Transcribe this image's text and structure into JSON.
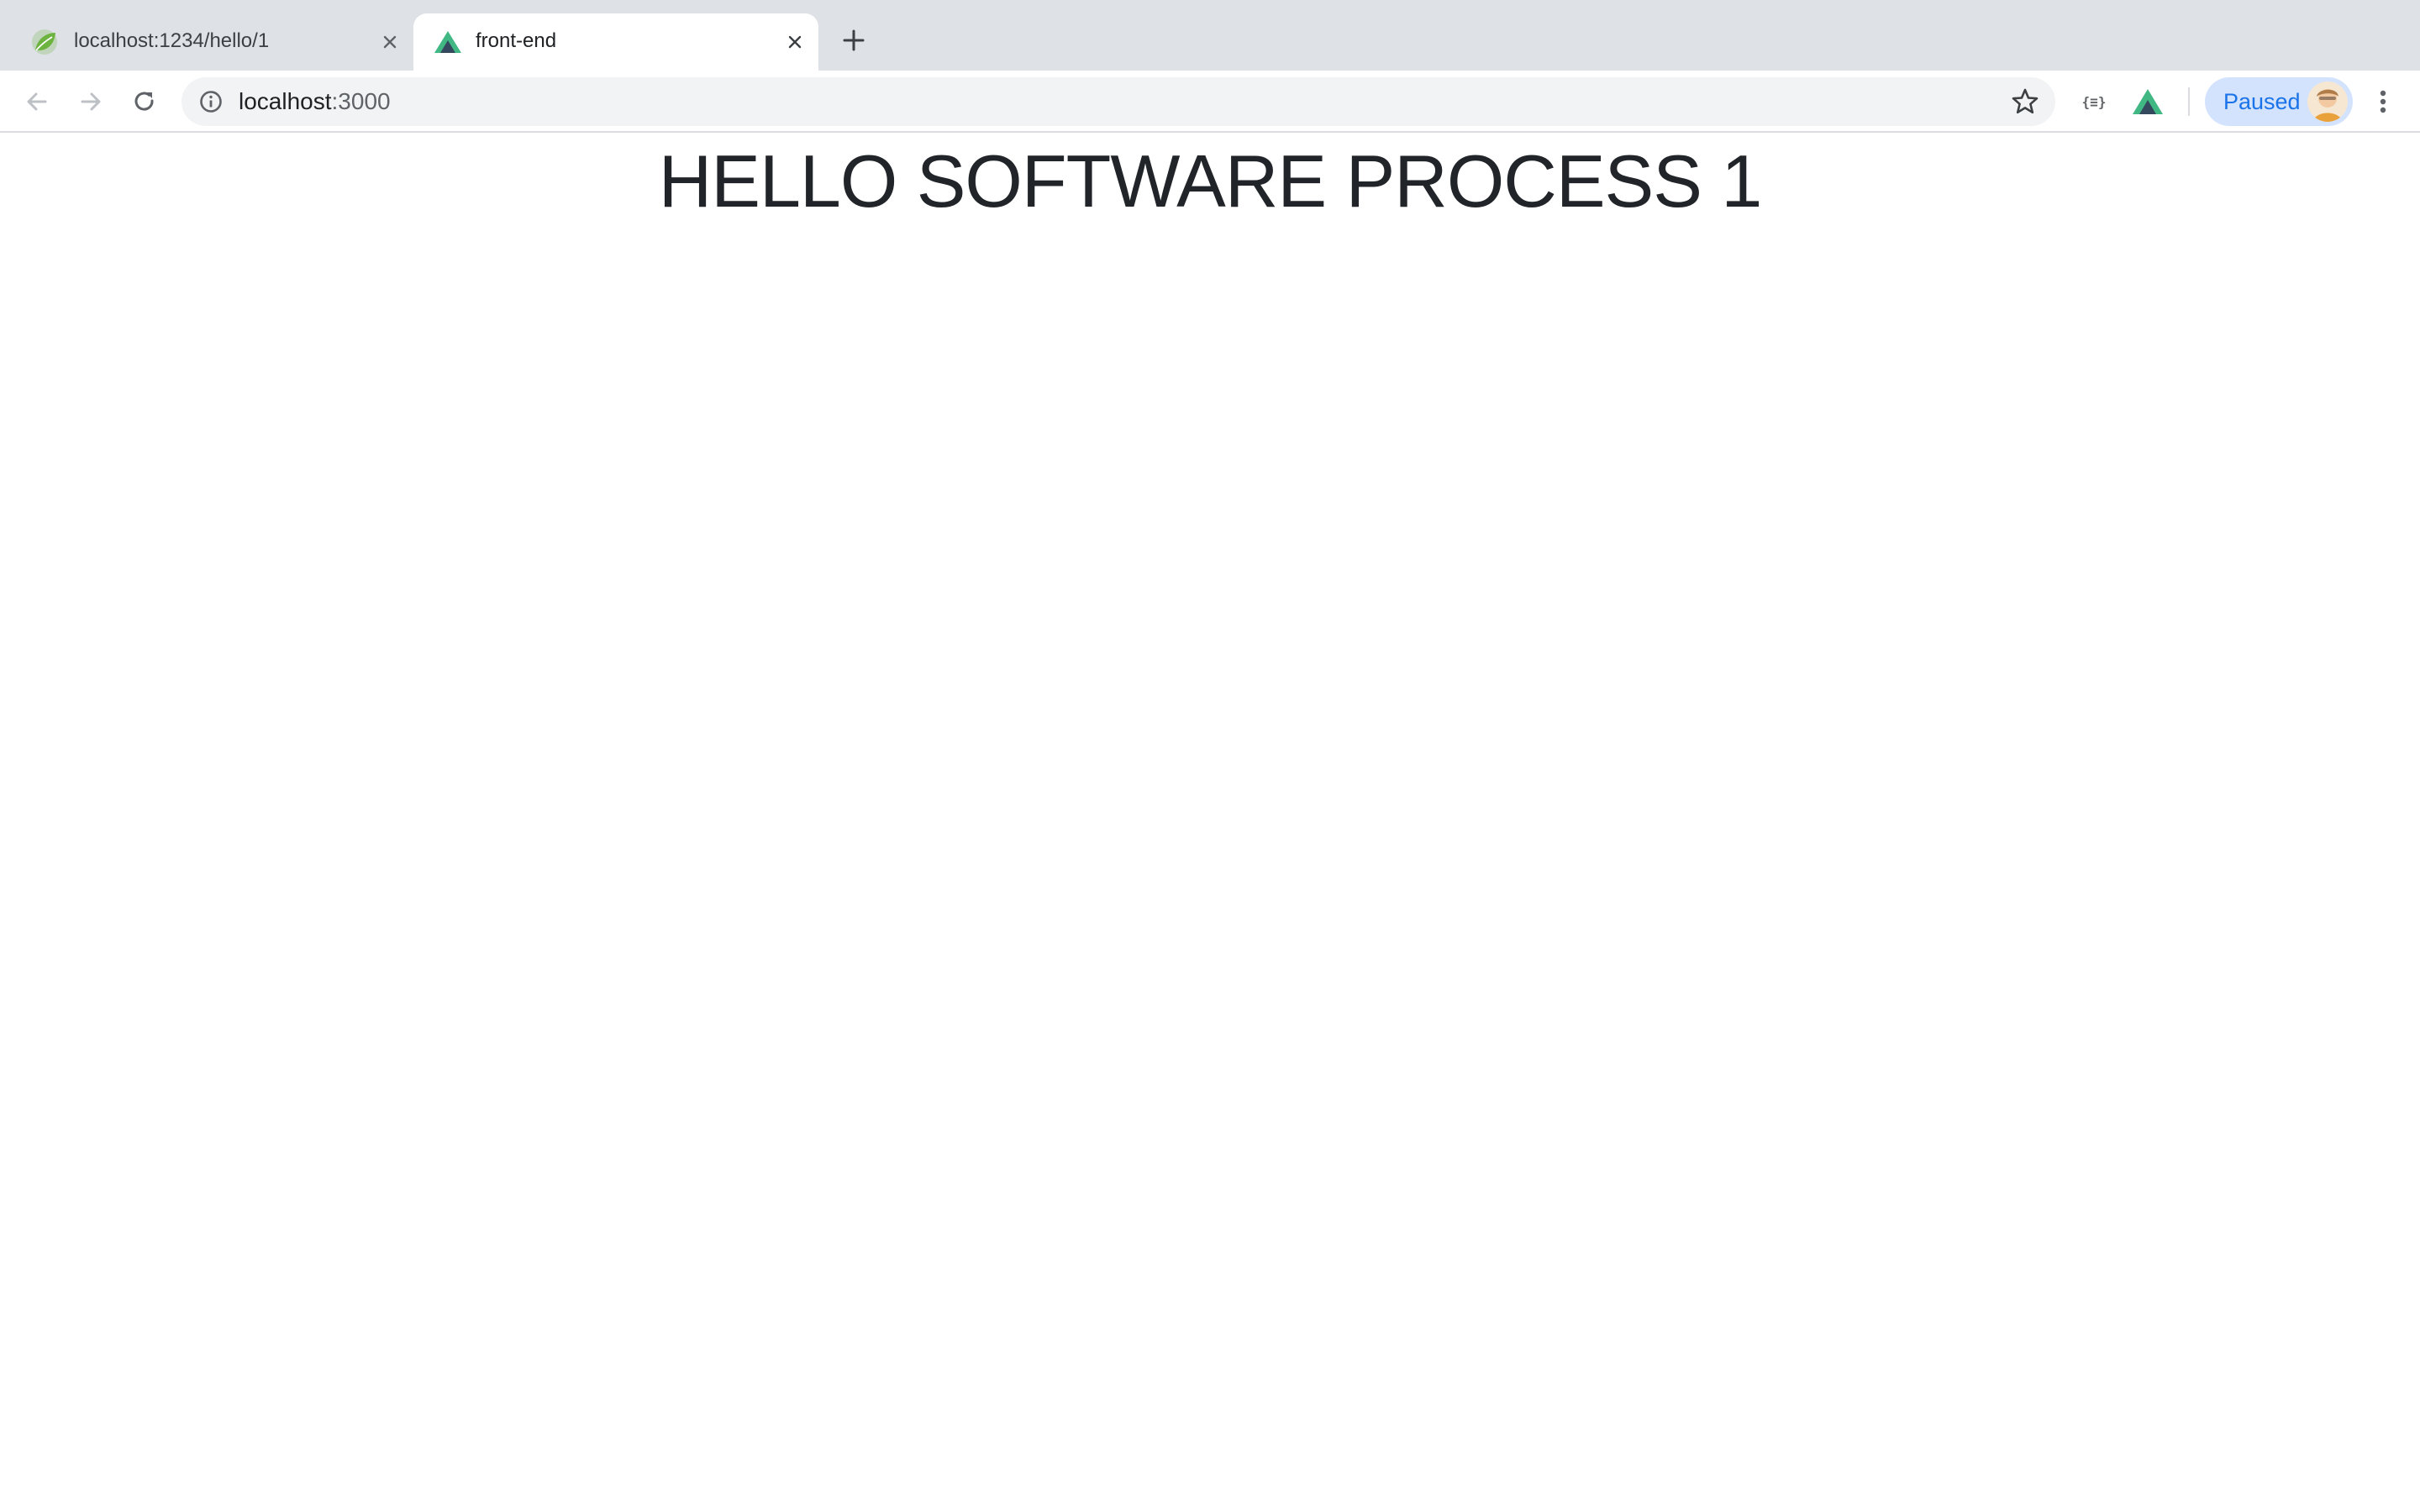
{
  "browser": {
    "tabs": [
      {
        "title": "localhost:1234/hello/1",
        "favicon": "spring-leaf-icon",
        "active": false
      },
      {
        "title": "front-end",
        "favicon": "vue-logo-icon",
        "active": true
      }
    ],
    "new_tab_icon": "plus-icon",
    "address_bar": {
      "host": "localhost",
      "port": ":3000"
    },
    "extensions": [
      {
        "name": "json-viewer-extension",
        "glyph": "{≡}"
      },
      {
        "name": "vue-devtools-extension",
        "icon": "vue-logo-icon"
      }
    ],
    "profile": {
      "label": "Paused"
    },
    "colors": {
      "tabstrip": "#dee1e6",
      "omnibox": "#f1f3f4",
      "profile_chip": "#d3e3fd",
      "profile_text": "#1a73e8"
    }
  },
  "page": {
    "heading": "HELLO SOFTWARE PROCESS 1"
  }
}
